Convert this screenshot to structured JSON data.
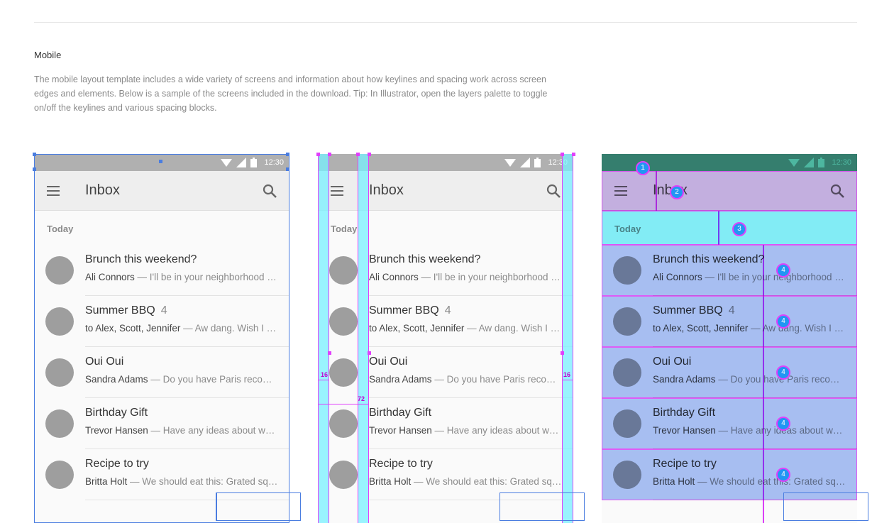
{
  "section": {
    "title": "Mobile",
    "description": "The mobile layout template includes a wide variety of screens and information about how keylines and spacing work across screen edges and elements. Below is a sample of the screens included in the download. Tip: In Illustrator, open the layers palette to toggle on/off the keylines and various spacing blocks."
  },
  "phone": {
    "status_time": "12:30",
    "appbar_title": "Inbox",
    "subheader": "Today",
    "icons": {
      "menu": "menu-icon",
      "search": "search-icon",
      "wifi": "wifi-icon",
      "signal": "signal-icon",
      "battery": "battery-icon"
    },
    "messages": [
      {
        "title": "Brunch this weekend?",
        "count": "",
        "from": "Ali Connors",
        "snippet": " — I'll be in your neighborhood doing errands this weekend."
      },
      {
        "title": "Summer BBQ",
        "count": "4",
        "from": "to Alex, Scott, Jennifer",
        "snippet": " — Aw dang. Wish I could make it."
      },
      {
        "title": "Oui Oui",
        "count": "",
        "from": "Sandra Adams",
        "snippet": " — Do you have Paris recommendations?"
      },
      {
        "title": "Birthday Gift",
        "count": "",
        "from": "Trevor Hansen",
        "snippet": " — Have any ideas about what we should get?"
      },
      {
        "title": "Recipe to try",
        "count": "",
        "from": "Britta Holt",
        "snippet": " — We should eat this: Grated squash."
      }
    ]
  },
  "keylines": {
    "left_margin": "16",
    "content_keyline": "72",
    "right_margin": "16"
  },
  "markers": [
    "1",
    "2",
    "3",
    "4",
    "4",
    "4",
    "4",
    "4"
  ],
  "colors": {
    "statusbar": "#b0b0b0",
    "appbar": "#eeeeee",
    "keyline_fill": "#78f0ff",
    "spacing_magenta": "#e040fb",
    "outline_blue": "#4a7de0",
    "overlay_green": "#43b39b",
    "overlay_purple": "#c9b0ec",
    "overlay_cyan": "#78f0fa",
    "overlay_blue": "#9bb8f5"
  }
}
